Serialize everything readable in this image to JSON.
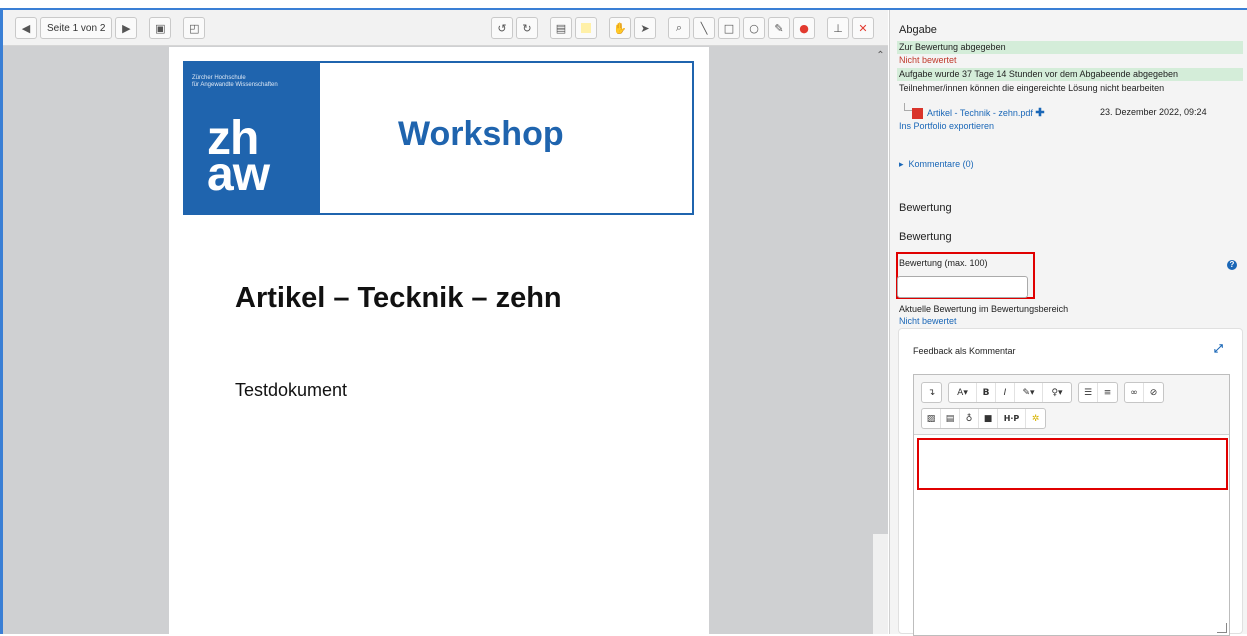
{
  "toolbar": {
    "page_label": "Seite 1 von 2",
    "prev_icon": "triangle-left-icon",
    "next_icon": "triangle-right-icon"
  },
  "document": {
    "logo_small_line1": "Zürcher Hochschule",
    "logo_small_line2": "für Angewandte Wissenschaften",
    "logo_line1": "zh",
    "logo_line2": "aw",
    "header_title": "Workshop",
    "title": "Artikel – Tecknik – zehn",
    "subtitle": "Testdokument"
  },
  "submission": {
    "heading": "Abgabe",
    "status_submitted": "Zur Bewertung abgegeben",
    "status_grade": "Nicht bewertet",
    "status_time": "Aufgabe wurde 37 Tage 14 Stunden vor dem Abgabeende abgegeben",
    "status_lock": "Teilnehmer/innen können die eingereichte Lösung nicht bearbeiten",
    "file_name": "Artikel - Technik - zehn.pdf",
    "file_date": "23. Dezember 2022, 09:24",
    "export_link": "Ins Portfolio exportieren",
    "comments_link": "Kommentare (0)"
  },
  "grading": {
    "section_title": "Bewertung",
    "subsection_title": "Bewertung",
    "grade_label": "Bewertung (max. 100)",
    "grade_value": "",
    "current_grade_label": "Aktuelle Bewertung im Bewertungsbereich",
    "current_grade_value": "Nicht bewertet"
  },
  "feedback": {
    "title": "Feedback als Kommentar"
  },
  "colors": {
    "accent_blue": "#1f64ae",
    "highlight_red": "#e00000",
    "status_green": "#d4edd9"
  }
}
